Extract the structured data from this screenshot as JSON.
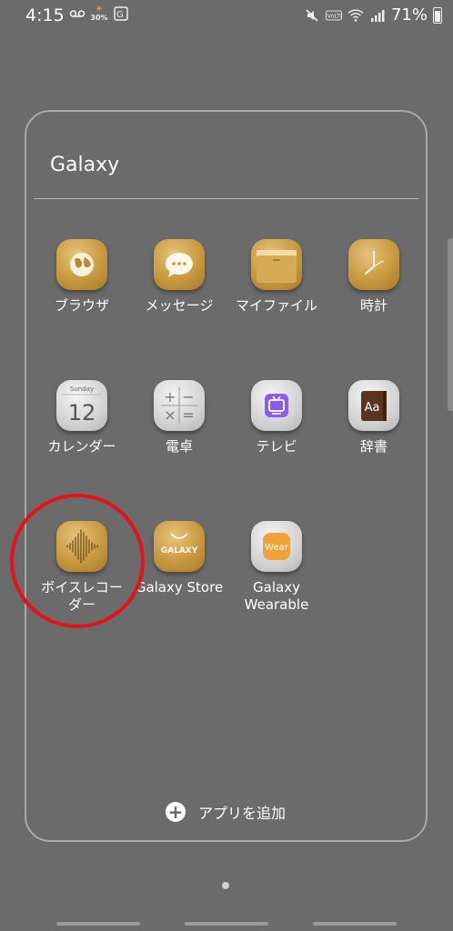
{
  "status_bar": {
    "time": "4:15",
    "weather_temp": "30%",
    "battery_percent": "71%"
  },
  "folder": {
    "title": "Galaxy",
    "apps": [
      {
        "label": "ブラウザ",
        "icon": "browser-globe-icon"
      },
      {
        "label": "メッセージ",
        "icon": "message-bubble-icon"
      },
      {
        "label": "マイファイル",
        "icon": "folder-icon"
      },
      {
        "label": "時計",
        "icon": "clock-icon"
      },
      {
        "label": "カレンダー",
        "icon": "calendar-icon",
        "day_name": "Sunday",
        "date": "12"
      },
      {
        "label": "電卓",
        "icon": "calculator-icon"
      },
      {
        "label": "テレビ",
        "icon": "tv-icon"
      },
      {
        "label": "辞書",
        "icon": "dictionary-icon",
        "glyph": "Aa"
      },
      {
        "label": "ボイスレコーダー",
        "label_line1": "ボイスレコー",
        "label_line2": "ダー",
        "icon": "voice-recorder-icon"
      },
      {
        "label": "Galaxy Store",
        "icon": "galaxy-store-bag-icon",
        "badge": "GALAXY"
      },
      {
        "label": "Galaxy Wearable",
        "label_line1": "Galaxy",
        "label_line2": "Wearable",
        "icon": "wear-icon",
        "badge": "Wear"
      }
    ],
    "add_apps_label": "アプリを追加"
  },
  "colors": {
    "background": "#6b6b6b",
    "highlight": "#e8101a",
    "gold": "#c8993f",
    "tv_purple": "#8a5cf0",
    "wear_orange": "#f0a23a"
  }
}
